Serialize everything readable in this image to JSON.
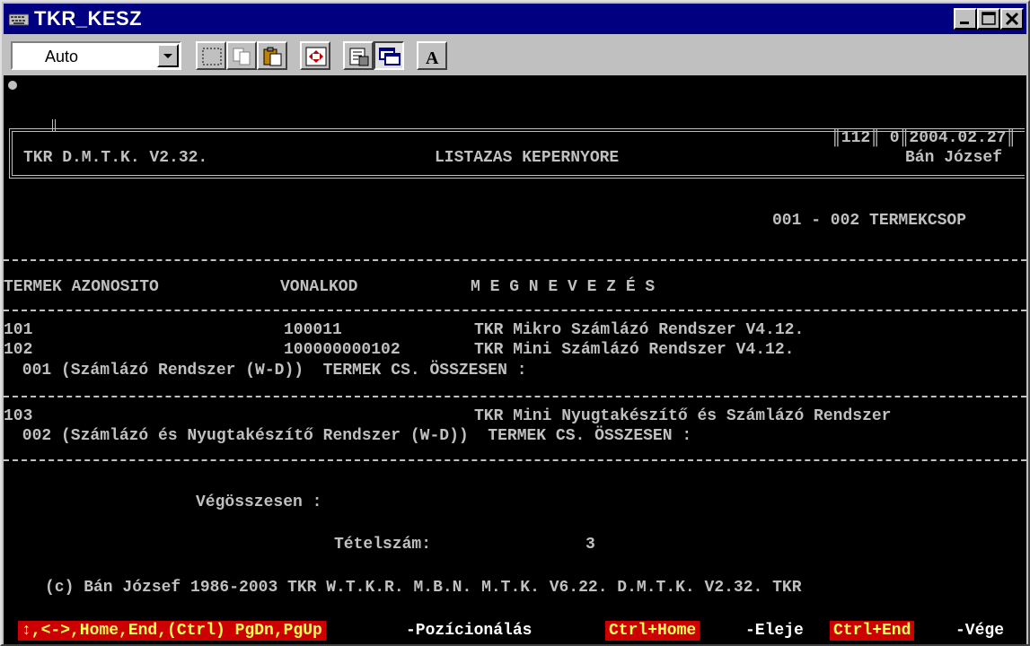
{
  "window": {
    "title": "TKR_KESZ"
  },
  "toolbar": {
    "font_value": "Auto"
  },
  "header": {
    "left": "TKR D.M.T.K. V2.32.",
    "center": "LISTAZAS KEPERNYORE",
    "badge": "║112║ 0║2004.02.27║",
    "user": "Bán József"
  },
  "range_label": "001 - 002 TERMEKCSOP",
  "columns": {
    "id": "TERMEK AZONOSITO",
    "barcode": "VONALKOD",
    "name": "M E G N E V E Z É S"
  },
  "groups": [
    {
      "rows": [
        {
          "id": "101",
          "barcode": "100011",
          "name": "TKR Mikro Számlázó Rendszer V4.12."
        },
        {
          "id": "102",
          "barcode": "100000000102",
          "name": "TKR Mini Számlázó Rendszer V4.12."
        }
      ],
      "total": " 001 (Számlázó Rendszer (W-D))  TERMEK CS. ÖSSZESEN :"
    },
    {
      "rows": [
        {
          "id": "103",
          "barcode": "",
          "name": "TKR Mini Nyugtakészítő és Számlázó Rendszer"
        }
      ],
      "total": " 002 (Számlázó és Nyugtakészítő Rendszer (W-D))  TERMEK CS. ÖSSZESEN :"
    }
  ],
  "summary": {
    "grand_total": "Végösszesen :",
    "count_label": "Tételszám:",
    "count_value": "3"
  },
  "copyright": "(c) Bán József 1986-2003 TKR W.T.K.R. M.B.N. M.T.K. V6.22. D.M.T.K. V2.32. TKR",
  "status": {
    "key1": "↕,<->,Home,End,(Ctrl) PgDn,PgUp",
    "desc1": "-Pozícionálás",
    "key2": "Ctrl+Home",
    "desc2": "-Eleje",
    "key3": "Ctrl+End",
    "desc3": "-Vége"
  },
  "colors": {
    "title_bar": "#000080",
    "console_bg": "#000000",
    "console_fg": "#c0c0c0",
    "status_key_bg": "#cc0000",
    "status_key_fg": "#ffff55"
  }
}
